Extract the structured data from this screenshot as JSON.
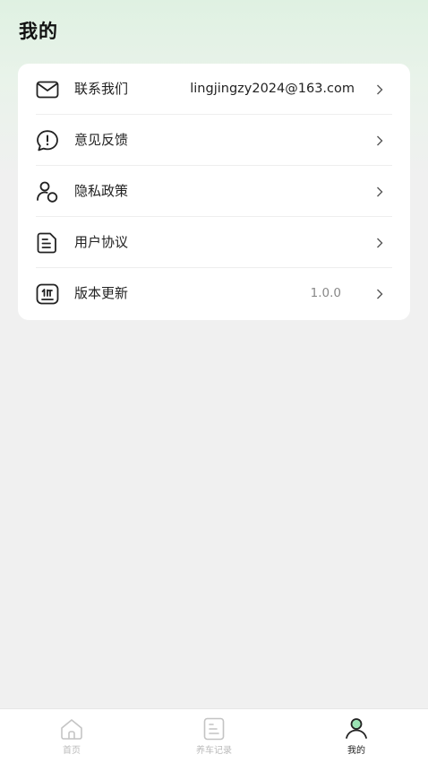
{
  "page": {
    "title": "我的"
  },
  "menu": {
    "items": [
      {
        "label": "联系我们",
        "value": "lingjingzy2024@163.com",
        "icon": "mail-icon"
      },
      {
        "label": "意见反馈",
        "value": "",
        "icon": "feedback-icon"
      },
      {
        "label": "隐私政策",
        "value": "",
        "icon": "privacy-icon"
      },
      {
        "label": "用户协议",
        "value": "",
        "icon": "document-icon"
      },
      {
        "label": "版本更新",
        "value": "1.0.0",
        "icon": "version-icon"
      }
    ]
  },
  "bottom_nav": {
    "items": [
      {
        "label": "首页",
        "icon": "home-icon",
        "active": false
      },
      {
        "label": "养车记录",
        "icon": "records-icon",
        "active": false
      },
      {
        "label": "我的",
        "icon": "profile-icon",
        "active": true
      }
    ]
  },
  "colors": {
    "header_gradient": "#dff1e2",
    "background": "#f0f0f0",
    "card": "#ffffff",
    "nav_inactive": "#bbbbbb",
    "nav_active": "#222222"
  }
}
